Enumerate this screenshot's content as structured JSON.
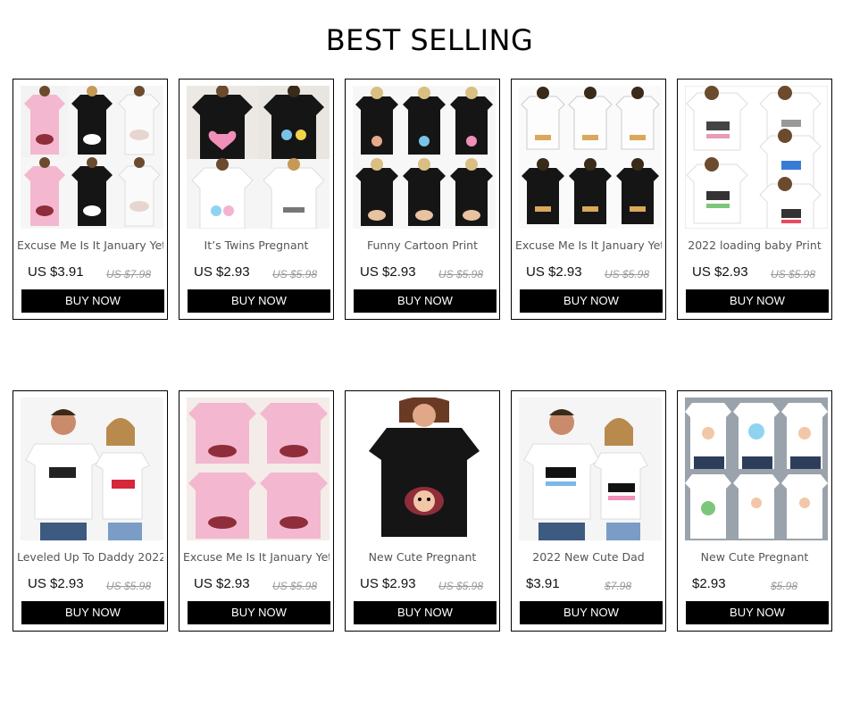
{
  "section": {
    "title": "BEST SELLING"
  },
  "products": [
    {
      "title": "Excuse Me Is It January Yet",
      "price": "US $3.91",
      "old_price": "US $7.98",
      "button": "BUY NOW",
      "image": "pink-black-white-maternity-tees-grid"
    },
    {
      "title": "It’s Twins Pregnant",
      "price": "US $2.93",
      "old_price": "US $5.98",
      "button": "BUY NOW",
      "image": "black-white-twins-maternity-tees-grid"
    },
    {
      "title": "Funny Cartoon Print",
      "price": "US $2.93",
      "old_price": "US $5.98",
      "button": "BUY NOW",
      "image": "black-cartoon-maternity-tees-grid"
    },
    {
      "title": "Excuse Me Is It January Yet",
      "price": "US $2.93",
      "old_price": "US $5.98",
      "button": "BUY NOW",
      "image": "white-black-maternity-tees-grid"
    },
    {
      "title": "2022 loading baby Print",
      "price": "US $2.93",
      "old_price": "US $5.98",
      "button": "BUY NOW",
      "image": "white-loading-baby-tees-grid"
    },
    {
      "title": "Leveled Up To Daddy 2022",
      "price": "US $2.93",
      "old_price": "US $5.98",
      "button": "BUY NOW",
      "image": "couple-papa-mama-tees"
    },
    {
      "title": "Excuse Me Is It January Yet",
      "price": "US $2.93",
      "old_price": "US $5.98",
      "button": "BUY NOW",
      "image": "pink-maternity-tees-grid"
    },
    {
      "title": "New Cute Pregnant",
      "price": "US $2.93",
      "old_price": "US $5.98",
      "button": "BUY NOW",
      "image": "black-peeking-baby-tee"
    },
    {
      "title": "2022 New Cute Dad",
      "price": "$3.91",
      "old_price": "$7.98",
      "button": "BUY NOW",
      "image": "couple-dad-mom-tees"
    },
    {
      "title": "New Cute Pregnant",
      "price": "$2.93",
      "old_price": "$5.98",
      "button": "BUY NOW",
      "image": "white-baby-print-tees-grid"
    }
  ],
  "colors": {
    "button_bg": "#000000",
    "button_text": "#ffffff",
    "border": "#000000",
    "old_price": "#999999",
    "pink_tee": "#f3b8cf",
    "black_tee": "#151515",
    "white_tee": "#f7f7f7"
  }
}
